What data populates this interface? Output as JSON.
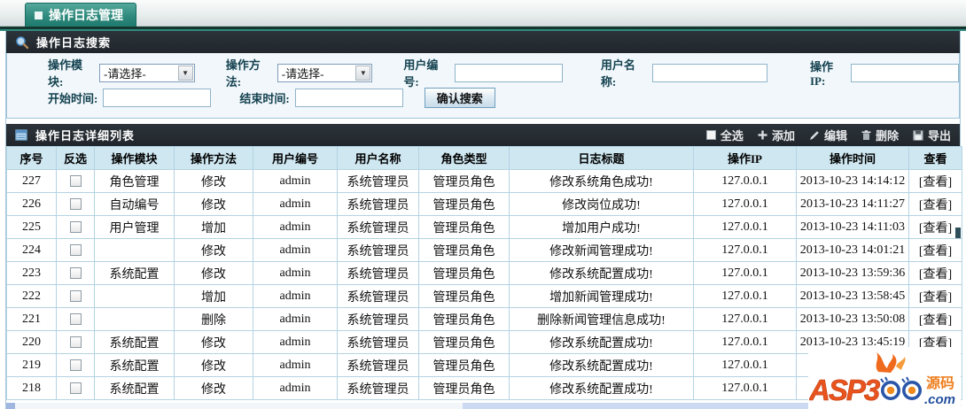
{
  "tab": {
    "label": "操作日志管理"
  },
  "search": {
    "title": "操作日志搜索",
    "module_label": "操作模块:",
    "module_value": "-请选择-",
    "method_label": "操作方法:",
    "method_value": "-请选择-",
    "user_id_label": "用户编号:",
    "user_name_label": "用户名称:",
    "ip_label": "操作IP:",
    "start_time_label": "开始时间:",
    "end_time_label": "结束时间:",
    "submit_label": "确认搜索"
  },
  "list": {
    "title": "操作日志详细列表",
    "toolbar": {
      "select_all": "全选",
      "add": "添加",
      "edit": "编辑",
      "delete": "删除",
      "export": "导出"
    }
  },
  "table": {
    "headers": [
      "序号",
      "反选",
      "操作模块",
      "操作方法",
      "用户编号",
      "用户名称",
      "角色类型",
      "日志标题",
      "操作IP",
      "操作时间",
      "查看"
    ],
    "rows": [
      {
        "seq": "227",
        "module": "角色管理",
        "method": "修改",
        "user_id": "admin",
        "user_name": "系统管理员",
        "role": "管理员角色",
        "title": "修改系统角色成功!",
        "ip": "127.0.0.1",
        "time": "2013-10-23 14:14:12",
        "view": "[查看]"
      },
      {
        "seq": "226",
        "module": "自动编号",
        "method": "修改",
        "user_id": "admin",
        "user_name": "系统管理员",
        "role": "管理员角色",
        "title": "修改岗位成功!",
        "ip": "127.0.0.1",
        "time": "2013-10-23 14:11:27",
        "view": "[查看]"
      },
      {
        "seq": "225",
        "module": "用户管理",
        "method": "增加",
        "user_id": "admin",
        "user_name": "系统管理员",
        "role": "管理员角色",
        "title": "增加用户成功!",
        "ip": "127.0.0.1",
        "time": "2013-10-23 14:11:03",
        "view": "[查看]"
      },
      {
        "seq": "224",
        "module": "",
        "method": "修改",
        "user_id": "admin",
        "user_name": "系统管理员",
        "role": "管理员角色",
        "title": "修改新闻管理成功!",
        "ip": "127.0.0.1",
        "time": "2013-10-23 14:01:21",
        "view": "[查看]"
      },
      {
        "seq": "223",
        "module": "系统配置",
        "method": "修改",
        "user_id": "admin",
        "user_name": "系统管理员",
        "role": "管理员角色",
        "title": "修改系统配置成功!",
        "ip": "127.0.0.1",
        "time": "2013-10-23 13:59:36",
        "view": "[查看]"
      },
      {
        "seq": "222",
        "module": "",
        "method": "增加",
        "user_id": "admin",
        "user_name": "系统管理员",
        "role": "管理员角色",
        "title": "增加新闻管理成功!",
        "ip": "127.0.0.1",
        "time": "2013-10-23 13:58:45",
        "view": "[查看]"
      },
      {
        "seq": "221",
        "module": "",
        "method": "删除",
        "user_id": "admin",
        "user_name": "系统管理员",
        "role": "管理员角色",
        "title": "删除新闻管理信息成功!",
        "ip": "127.0.0.1",
        "time": "2013-10-23 13:50:08",
        "view": "[查看]"
      },
      {
        "seq": "220",
        "module": "系统配置",
        "method": "修改",
        "user_id": "admin",
        "user_name": "系统管理员",
        "role": "管理员角色",
        "title": "修改系统配置成功!",
        "ip": "127.0.0.1",
        "time": "2013-10-23 13:45:19",
        "view": "[查看]"
      },
      {
        "seq": "219",
        "module": "系统配置",
        "method": "修改",
        "user_id": "admin",
        "user_name": "系统管理员",
        "role": "管理员角色",
        "title": "修改系统配置成功!",
        "ip": "127.0.0.1",
        "time": "2013",
        "view": ""
      },
      {
        "seq": "218",
        "module": "系统配置",
        "method": "修改",
        "user_id": "admin",
        "user_name": "系统管理员",
        "role": "管理员角色",
        "title": "修改系统配置成功!",
        "ip": "127.0.0.1",
        "time": "2013",
        "view": ""
      }
    ]
  },
  "watermark": {
    "brand_a": "ASP3",
    "tag": "源码",
    "domain": ".com"
  },
  "colors": {
    "tab_teal": "#2f8a7d",
    "accent_dark_teal": "#14362f",
    "accent_teal": "#2e8b7f",
    "bar_dark": "#23282d",
    "table_header_bg": "#cfe7f1",
    "table_border": "#b4d3e3",
    "panel_border": "#9fc3d9",
    "label_color": "#14424f",
    "wm_orange": "#e8541e",
    "wm_blue": "#24509e"
  }
}
